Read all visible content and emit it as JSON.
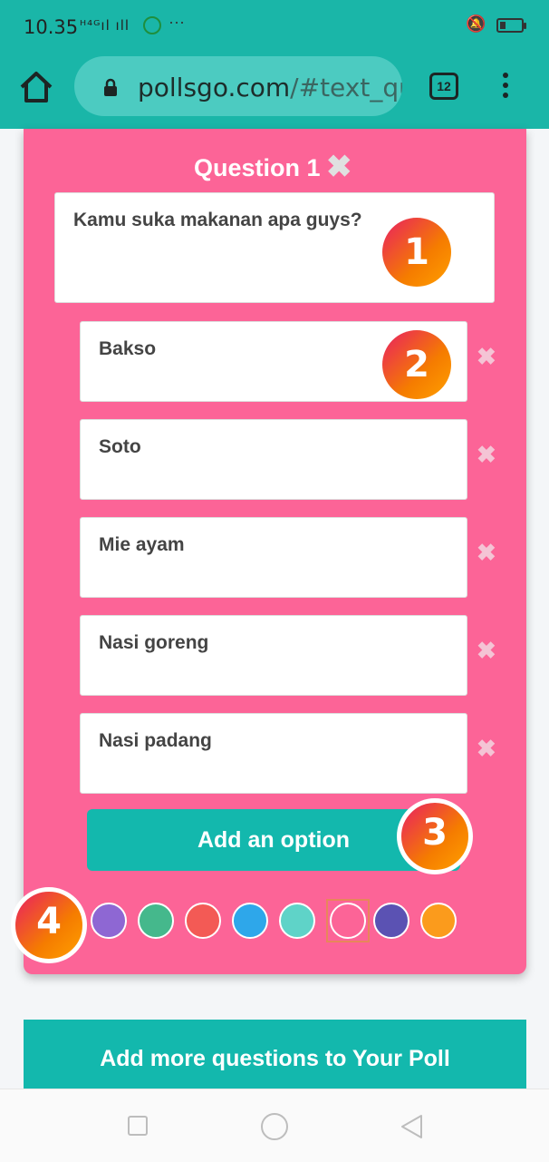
{
  "status_bar": {
    "time": "10.35",
    "network": "ᴴ⁴ᴳıl ıll",
    "more": "···"
  },
  "browser": {
    "url_host": "pollsgo.com",
    "url_path": "/#text_qu",
    "tab_count": "12"
  },
  "question": {
    "title": "Question 1",
    "text": "Kamu suka makanan apa guys?",
    "options": [
      "Bakso",
      "Soto",
      "Mie ayam",
      "Nasi goreng",
      "Nasi padang"
    ],
    "add_option_label": "Add an option"
  },
  "colors": {
    "swatches": [
      "#8e67d3",
      "#45b88c",
      "#f35a55",
      "#2ea7ea",
      "#5fd3c8",
      "#fc6497",
      "#5b52b3",
      "#fb9b1c"
    ],
    "selected_index": 5,
    "accent": "#13b8ad",
    "card": "#fc6497"
  },
  "badges": [
    "1",
    "2",
    "3",
    "4"
  ],
  "footer": {
    "add_more_label": "Add more questions to Your Poll"
  }
}
